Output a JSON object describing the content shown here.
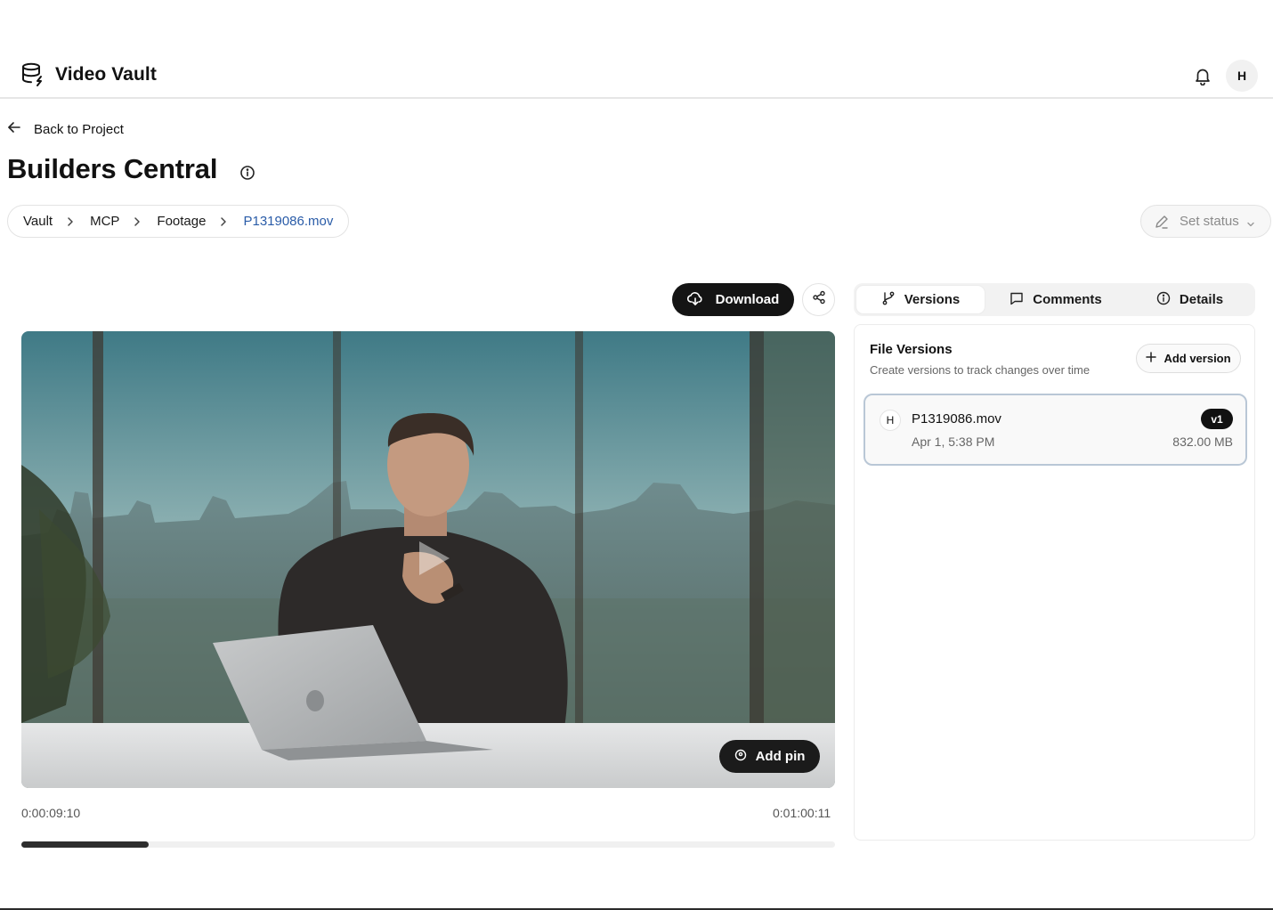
{
  "app": {
    "name": "Video Vault",
    "user_initial": "H"
  },
  "nav": {
    "back_label": "Back to Project"
  },
  "page": {
    "title": "Builders Central"
  },
  "breadcrumb": [
    {
      "label": "Vault"
    },
    {
      "label": "MCP"
    },
    {
      "label": "Footage"
    },
    {
      "label": "P1319086.mov"
    }
  ],
  "status": {
    "label": "Set status"
  },
  "toolbar": {
    "download_label": "Download"
  },
  "player": {
    "add_pin_label": "Add pin",
    "current_time": "0:00:09:10",
    "duration": "0:01:00:11",
    "progress_fraction": 0.156
  },
  "tabs": [
    {
      "label": "Versions",
      "icon": "git-branch-icon",
      "active": true
    },
    {
      "label": "Comments",
      "icon": "comment-icon",
      "active": false
    },
    {
      "label": "Details",
      "icon": "info-icon",
      "active": false
    }
  ],
  "versions": {
    "title": "File Versions",
    "subtitle": "Create versions to track changes over time",
    "add_label": "Add version",
    "items": [
      {
        "author_initial": "H",
        "file_name": "P1319086.mov",
        "date": "Apr 1, 5:38 PM",
        "badge": "v1",
        "size": "832.00 MB"
      }
    ]
  },
  "colors": {
    "accent_link": "#2a5ca8",
    "dark_button": "#141414",
    "card_border": "#b9c7d6"
  }
}
